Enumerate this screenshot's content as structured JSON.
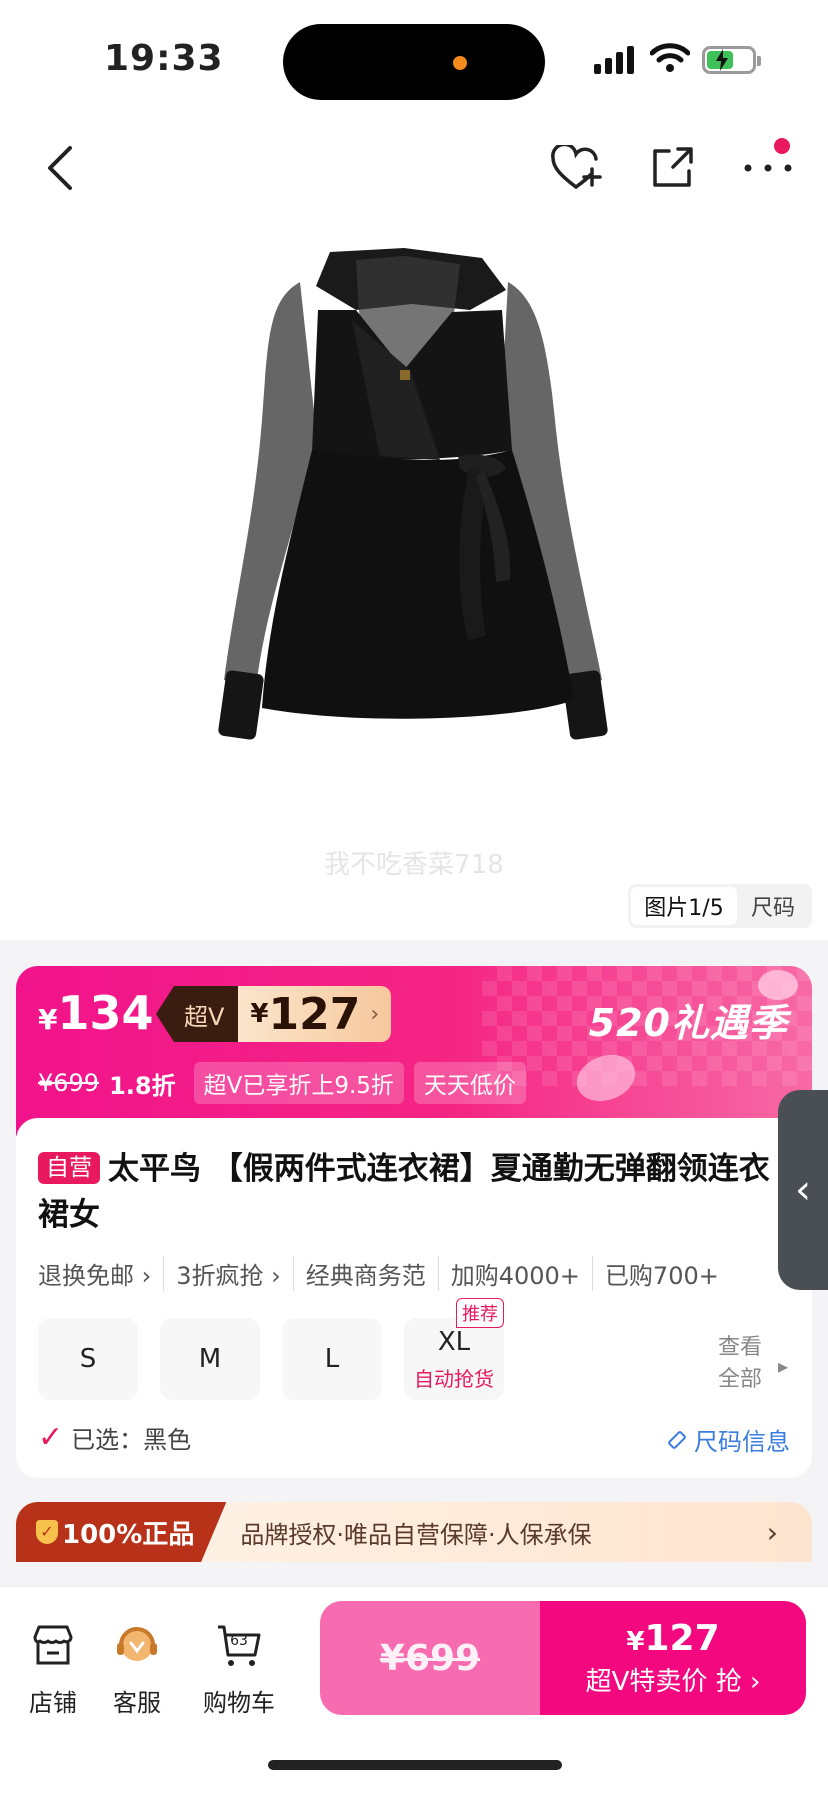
{
  "status_bar": {
    "time": "19:33"
  },
  "gallery": {
    "watermark": "我不吃香菜718",
    "tab_images": "图片1/5",
    "tab_size": "尺码"
  },
  "price": {
    "current_yen": "¥",
    "current": "134",
    "superv_label": "超V",
    "superv_yen": "¥",
    "superv_price": "127",
    "original": "¥699",
    "discount": "1.8折",
    "chip1": "超V已享折上9.5折",
    "chip2": "天天低价",
    "season": "520礼遇季"
  },
  "product": {
    "self_operated": "自营",
    "title": "太平鸟 【假两件式连衣裙】夏通勤无弹翻领连衣裙女",
    "tags": [
      "退换免邮 ›",
      "3折疯抢 ›",
      "经典商务范",
      "加购4000+",
      "已购700+"
    ],
    "sizes": [
      {
        "label": "S"
      },
      {
        "label": "M"
      },
      {
        "label": "L"
      },
      {
        "label": "XL",
        "sub": "自动抢货",
        "badge": "推荐"
      }
    ],
    "view_all": "查看全部",
    "selected": "已选：黑色",
    "size_info": "尺码信息"
  },
  "auth": {
    "badge": "100%正品",
    "text": "品牌授权·唯品自营保障·人保承保"
  },
  "bottom_bar": {
    "store": "店铺",
    "service": "客服",
    "cart": "购物车",
    "cart_count": "63",
    "orig_price": "¥699",
    "buy_yen": "¥",
    "buy_price": "127",
    "buy_label": "超V特卖价 抢 ›"
  },
  "colors": {
    "accent": "#e8195f",
    "banner": "#f1138b",
    "buy": "#f3087f"
  }
}
